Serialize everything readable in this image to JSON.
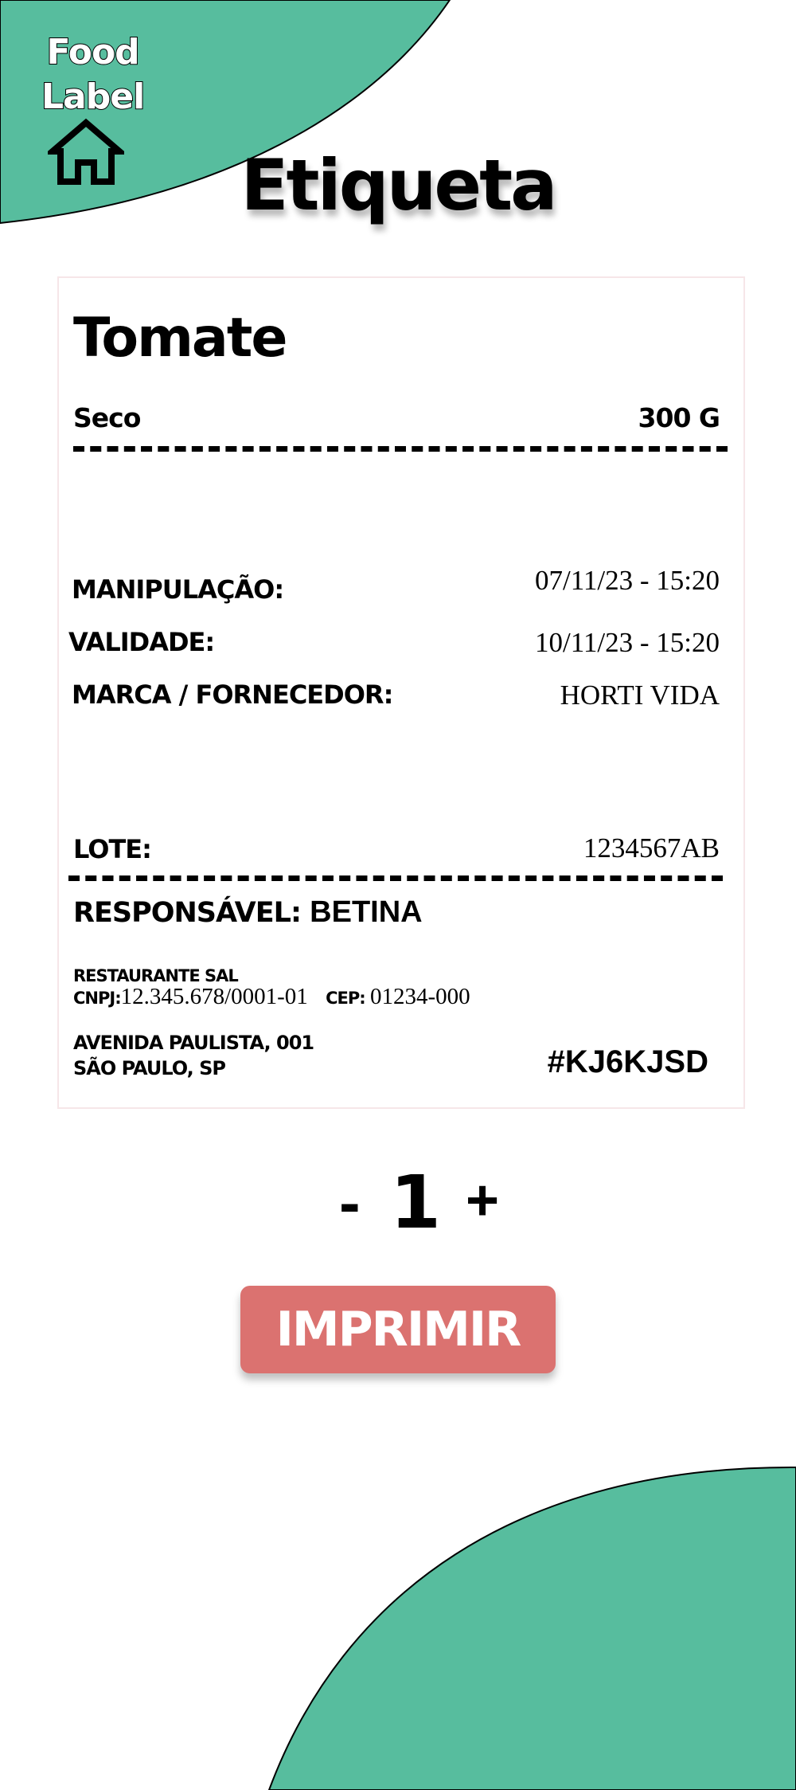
{
  "header": {
    "logo_line1": "Food",
    "logo_line2": "Label",
    "title": "Etiqueta"
  },
  "label": {
    "product": "Tomate",
    "storage": "Seco",
    "weight": "300 G",
    "rows": [
      {
        "key": "MANIPULAÇÃO:",
        "value": "07/11/23 - 15:20"
      },
      {
        "key": "VALIDADE:",
        "value": "10/11/23 - 15:20"
      },
      {
        "key": "MARCA / FORNECEDOR:",
        "value": "HORTI VIDA"
      }
    ],
    "lot_key": "LOTE:",
    "lot_value": "1234567AB",
    "responsible_key": "RESPONSÁVEL:",
    "responsible_value": "BETINA",
    "company": "RESTAURANTE  SAL",
    "cnpj_key": "CNPJ:",
    "cnpj_value": "12.345.678/0001-01",
    "cep_key": "CEP:",
    "cep_value": "01234-000",
    "address_line1": "AVENIDA PAULISTA, 001",
    "address_line2": "SÃO PAULO, SP",
    "code": "#KJ6KJSD"
  },
  "quantity": {
    "minus": "-",
    "value": "1",
    "plus": "+"
  },
  "print_label": "IMPRIMIR",
  "colors": {
    "accent_green": "#57bd9e",
    "button_red": "#db7270",
    "card_border": "#f6e6e8"
  },
  "icons": [
    "home-icon"
  ]
}
